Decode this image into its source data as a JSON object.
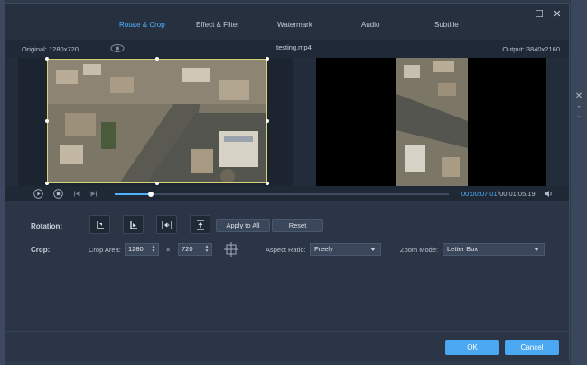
{
  "tabs": [
    {
      "label": "Rotate & Crop",
      "active": true
    },
    {
      "label": "Effect & Filter",
      "active": false
    },
    {
      "label": "Watermark",
      "active": false
    },
    {
      "label": "Audio",
      "active": false
    },
    {
      "label": "Subtitle",
      "active": false
    }
  ],
  "info": {
    "original": "Original: 1280x720",
    "filename": "testing.mp4",
    "output": "Output: 3840x2160"
  },
  "player": {
    "current_time": "00:00:07.01",
    "total_time": "/00:01:05.19",
    "progress_fraction": 0.107
  },
  "rotation": {
    "label": "Rotation:",
    "apply_all": "Apply to All",
    "reset": "Reset"
  },
  "crop": {
    "label": "Crop:",
    "area_label": "Crop Area:",
    "width": "1280",
    "times": "×",
    "height": "720",
    "aspect_label": "Aspect Ratio:",
    "aspect_value": "Freely",
    "zoom_label": "Zoom Mode:",
    "zoom_value": "Letter Box"
  },
  "footer": {
    "ok": "OK",
    "cancel": "Cancel"
  },
  "colors": {
    "accent": "#4fb2ff",
    "button": "#4aa8f2",
    "crop_frame": "#d6d27a"
  }
}
